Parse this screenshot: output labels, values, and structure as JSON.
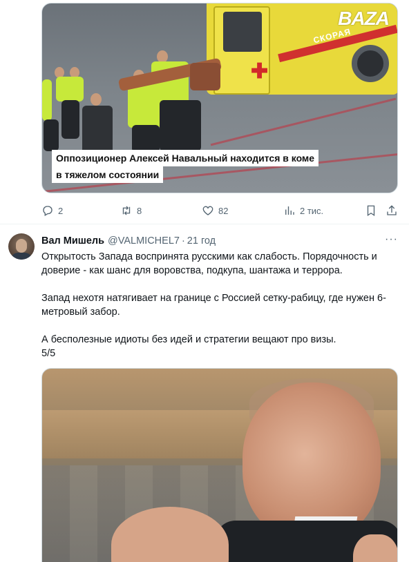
{
  "previous_tweet": {
    "media": {
      "watermark": "BAZA",
      "vehicle_text": "СКОРАЯ",
      "caption_line1": "Оппозиционер Алексей Навальный находится в коме",
      "caption_line2": "в тяжелом состоянии"
    },
    "actions": {
      "replies": "2",
      "retweets": "8",
      "likes": "82",
      "views": "2 тис."
    }
  },
  "tweet": {
    "display_name": "Вал Мишель",
    "handle": "@VALMICHEL7",
    "separator": "·",
    "time": "21 год",
    "more": "···",
    "body": {
      "line1": "Открытость Запада воспринята русскими как слабость. Порядочность и",
      "line2": "доверие - как шанс для воровства, подкупа, шантажа и террора.",
      "line3": "Запад нехотя натягивает на границе с Россией сетку-рабицу, где нужен 6-",
      "line4": "метровый забор.",
      "line5": "А бесполезные идиоты без идей и стратегии вещают про визы.",
      "line6": "5/5"
    }
  },
  "colors": {
    "secondary_text": "#536471",
    "border": "#cfd9de",
    "vest": "#c7e93a",
    "ambulance": "#e8d93a"
  },
  "icons": {
    "reply": "reply-icon",
    "retweet": "retweet-icon",
    "like": "heart-icon",
    "views": "bar-chart-icon",
    "bookmark": "bookmark-icon",
    "share": "share-icon"
  }
}
